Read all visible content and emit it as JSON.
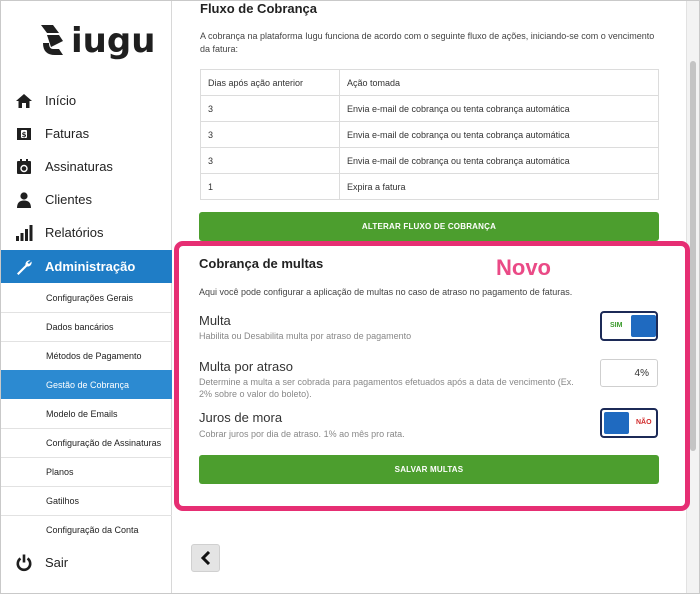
{
  "brand": {
    "name": "iugu"
  },
  "nav": {
    "main": [
      {
        "label": "Início",
        "icon": "home-icon"
      },
      {
        "label": "Faturas",
        "icon": "invoice-icon"
      },
      {
        "label": "Assinaturas",
        "icon": "calendar-icon"
      },
      {
        "label": "Clientes",
        "icon": "user-icon"
      },
      {
        "label": "Relatórios",
        "icon": "bar-chart-icon"
      },
      {
        "label": "Administração",
        "icon": "wrench-icon"
      }
    ],
    "sub": [
      {
        "label": "Configurações Gerais"
      },
      {
        "label": "Dados bancários"
      },
      {
        "label": "Métodos de Pagamento"
      },
      {
        "label": "Gestão de Cobrança"
      },
      {
        "label": "Modelo de Emails"
      },
      {
        "label": "Configuração de Assinaturas"
      },
      {
        "label": "Planos"
      },
      {
        "label": "Gatilhos"
      },
      {
        "label": "Configuração da Conta"
      }
    ],
    "logout": {
      "label": "Sair",
      "icon": "power-icon"
    }
  },
  "flow": {
    "title": "Fluxo de Cobrança",
    "description": "A cobrança na plataforma Iugu funciona de acordo com o seguinte fluxo de ações, iniciando-se com o vencimento da fatura:",
    "columns": [
      "Dias após ação anterior",
      "Ação tomada"
    ],
    "rows": [
      [
        "3",
        "Envia e-mail de cobrança ou tenta cobrança automática"
      ],
      [
        "3",
        "Envia e-mail de cobrança ou tenta cobrança automática"
      ],
      [
        "3",
        "Envia e-mail de cobrança ou tenta cobrança automática"
      ],
      [
        "1",
        "Expira a fatura"
      ]
    ],
    "button_label": "ALTERAR FLUXO DE COBRANÇA"
  },
  "fines": {
    "badge": "Novo",
    "title": "Cobrança de multas",
    "description": "Aqui você pode configurar a aplicação de multas no caso de atraso no pagamento de faturas.",
    "multa": {
      "title": "Multa",
      "help": "Habilita ou Desabilita multa por atraso de pagamento",
      "toggle_label": "SIM"
    },
    "multa_atraso": {
      "title": "Multa por atraso",
      "help_line1": "Determine a multa a ser cobrada para pagamentos efetuados após a data de vencimento (Ex.",
      "help_line2": "2% sobre o valor do boleto).",
      "value": "4%"
    },
    "juros": {
      "title": "Juros de mora",
      "help": "Cobrar juros por dia de atraso. 1% ao mês pro rata.",
      "toggle_label": "NÃO"
    },
    "save_label": "SALVAR MULTAS"
  },
  "colors": {
    "active_nav": "#1f7dc6",
    "green": "#4c9e2e",
    "highlight": "#e62e73",
    "toggle": "#1f6ac0"
  }
}
